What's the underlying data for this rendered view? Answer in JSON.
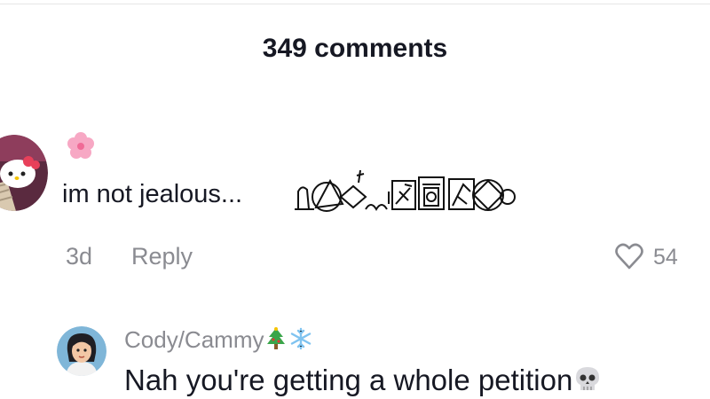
{
  "header": {
    "comment_count_label": "349 comments"
  },
  "comments": [
    {
      "avatar_icon": "hello-kitty-avatar",
      "username_emoji_icon": "pink-flower-icon",
      "text": "im not jealous...",
      "decorative_glyphs_icon": "hieroglyph-symbols",
      "time": "3d",
      "reply_label": "Reply",
      "like_icon": "heart-outline-icon",
      "like_count": "54"
    },
    {
      "avatar_icon": "cartoon-girl-avatar",
      "username": "Cody/Cammy",
      "username_emoji_icons": [
        "christmas-tree-icon",
        "snowflake-icon"
      ],
      "text": "Nah you're getting a whole petition",
      "text_emoji_icon": "skull-icon"
    }
  ],
  "colors": {
    "primary_text": "#161823",
    "secondary_text": "#8a8b91",
    "divider": "#e6e6e6"
  }
}
